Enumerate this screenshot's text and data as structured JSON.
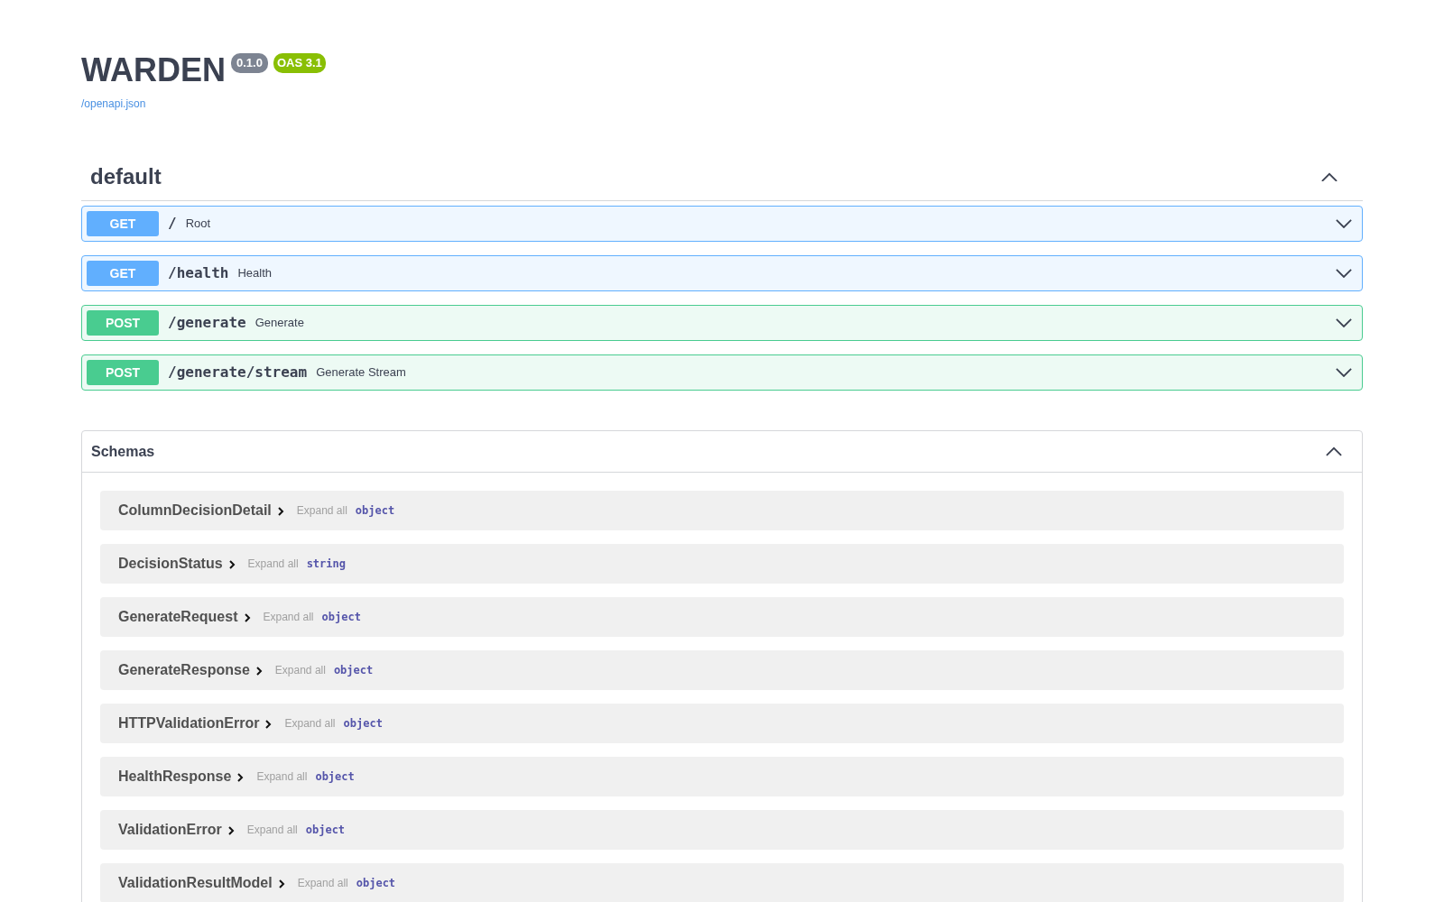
{
  "info": {
    "title": "WARDEN",
    "version": "0.1.0",
    "oas": "OAS 3.1",
    "spec_link": "/openapi.json"
  },
  "tag": {
    "name": "default",
    "expanded": true,
    "operations": [
      {
        "method": "GET",
        "path": "/",
        "summary": "Root",
        "expanded": false
      },
      {
        "method": "GET",
        "path": "/health",
        "summary": "Health",
        "expanded": false
      },
      {
        "method": "POST",
        "path": "/generate",
        "summary": "Generate",
        "expanded": false
      },
      {
        "method": "POST",
        "path": "/generate/stream",
        "summary": "Generate Stream",
        "expanded": false
      }
    ]
  },
  "schemas": {
    "title": "Schemas",
    "expanded": true,
    "items": [
      {
        "name": "ColumnDecisionDetail",
        "expand_all": "Expand all",
        "type": "object"
      },
      {
        "name": "DecisionStatus",
        "expand_all": "Expand all",
        "type": "string"
      },
      {
        "name": "GenerateRequest",
        "expand_all": "Expand all",
        "type": "object"
      },
      {
        "name": "GenerateResponse",
        "expand_all": "Expand all",
        "type": "object"
      },
      {
        "name": "HTTPValidationError",
        "expand_all": "Expand all",
        "type": "object"
      },
      {
        "name": "HealthResponse",
        "expand_all": "Expand all",
        "type": "object"
      },
      {
        "name": "ValidationError",
        "expand_all": "Expand all",
        "type": "object"
      },
      {
        "name": "ValidationResultModel",
        "expand_all": "Expand all",
        "type": "object"
      }
    ]
  }
}
